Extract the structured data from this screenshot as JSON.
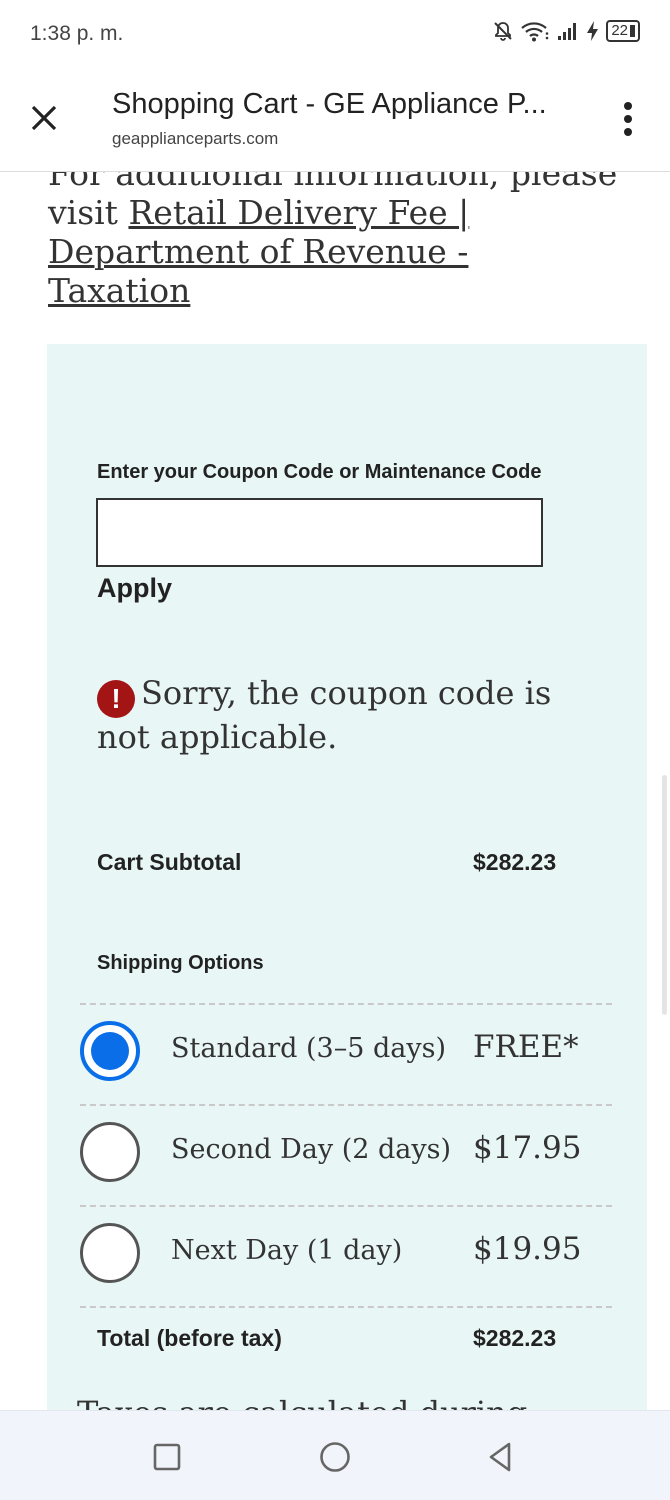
{
  "status_bar": {
    "time": "1:38 p. m.",
    "battery": "22",
    "icons": [
      "mute-bell-icon",
      "wifi-icon",
      "signal-icon",
      "charging-icon",
      "battery-icon"
    ]
  },
  "browser": {
    "title": "Shopping Cart - GE Appliance P...",
    "domain": "geapplianceparts.com",
    "close_icon": "close-icon",
    "menu_icon": "more-vertical-icon"
  },
  "info": {
    "text_before": "For additional information, please visit ",
    "link_text": "Retail Delivery Fee | Department of Revenue - Taxation"
  },
  "coupon": {
    "label": "Enter your Coupon Code or Maintenance Code",
    "value": "",
    "placeholder": "",
    "apply_label": "Apply",
    "error_icon": "!",
    "error_text": "Sorry, the coupon code is not applicable."
  },
  "summary": {
    "subtotal_label": "Cart Subtotal",
    "subtotal_value": "$282.23",
    "shipping_label": "Shipping Options",
    "shipping_options": [
      {
        "name": "Standard (3–5 days)",
        "price": "FREE*",
        "selected": true
      },
      {
        "name": "Second Day (2 days)",
        "price": "$17.95",
        "selected": false
      },
      {
        "name": "Next Day (1 day)",
        "price": "$19.95",
        "selected": false
      }
    ],
    "total_label": "Total (before tax)",
    "total_value": "$282.23",
    "tax_note": "Taxes are calculated during"
  },
  "nav_bar": {
    "icons": [
      "recents-square-icon",
      "home-circle-icon",
      "back-triangle-icon"
    ]
  },
  "colors": {
    "panel_bg": "#e8f6f6",
    "radio_selected": "#0a6ee8",
    "error_red": "#a31515"
  }
}
